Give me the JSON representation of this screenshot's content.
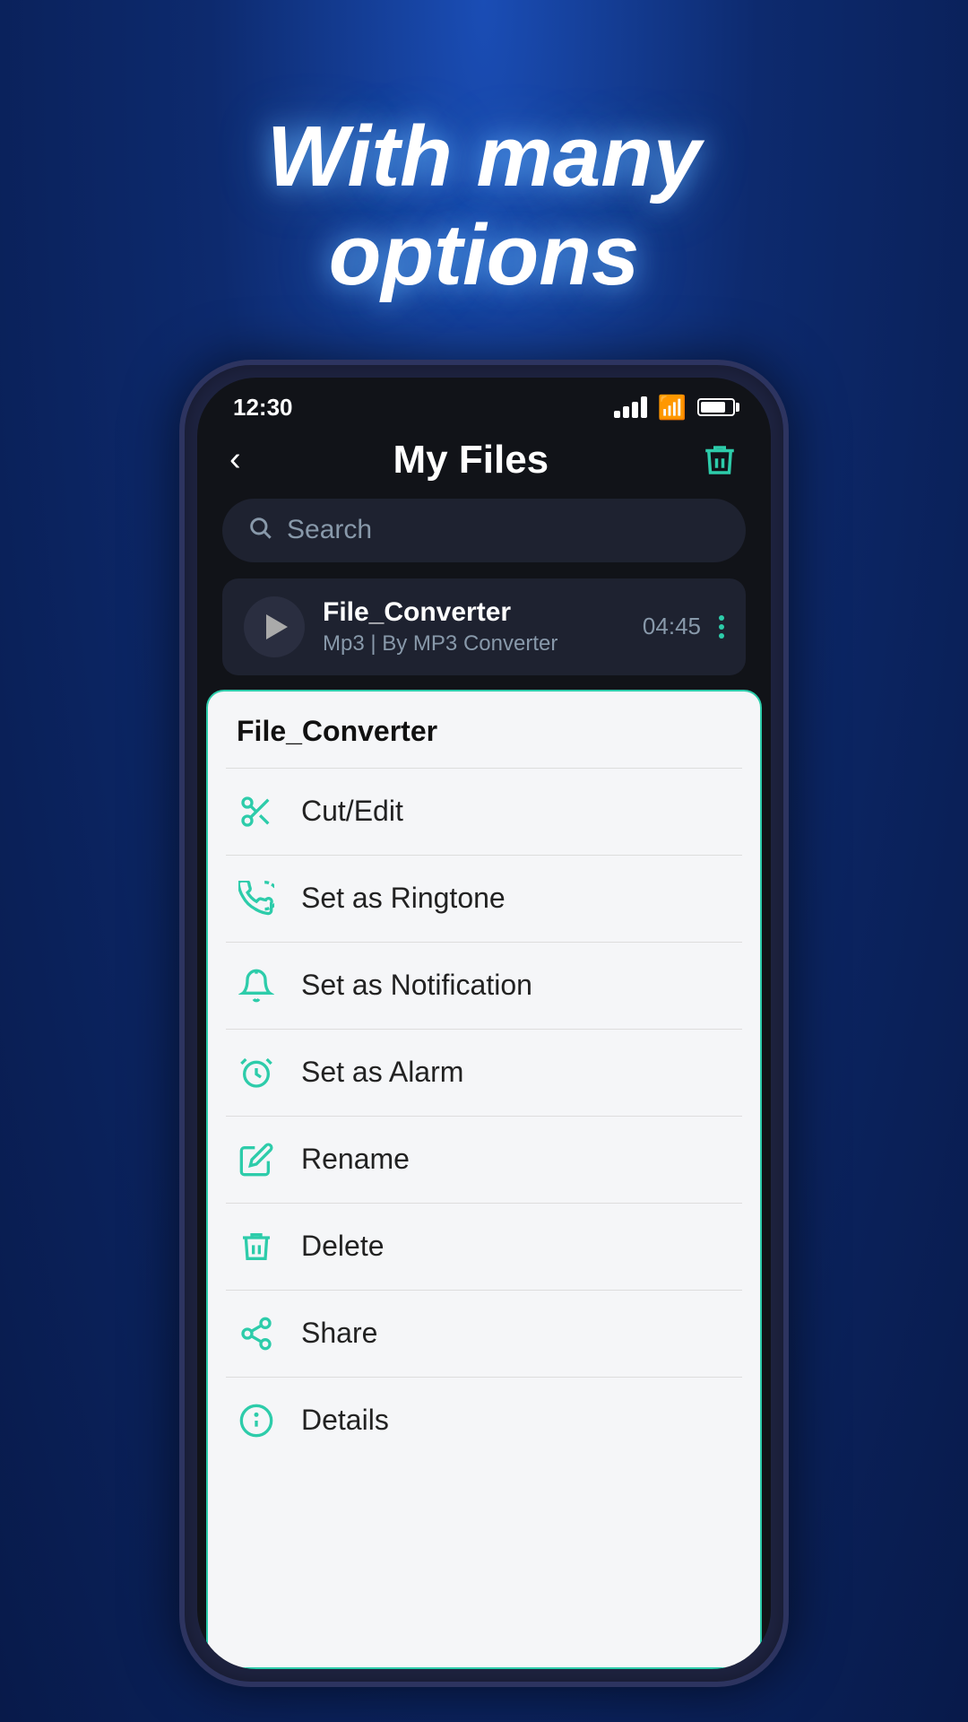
{
  "headline": {
    "line1": "With many",
    "line2": "options"
  },
  "status_bar": {
    "time": "12:30"
  },
  "app_bar": {
    "title": "My Files"
  },
  "search": {
    "placeholder": "Search"
  },
  "file_item": {
    "name": "File_Converter",
    "meta": "Mp3 | By MP3 Converter",
    "duration": "04:45"
  },
  "context_menu": {
    "title": "File_Converter",
    "items": [
      {
        "id": "cut-edit",
        "label": "Cut/Edit",
        "icon": "scissors"
      },
      {
        "id": "set-ringtone",
        "label": "Set as Ringtone",
        "icon": "phone"
      },
      {
        "id": "set-notification",
        "label": "Set as Notification",
        "icon": "bell"
      },
      {
        "id": "set-alarm",
        "label": "Set as Alarm",
        "icon": "alarm"
      },
      {
        "id": "rename",
        "label": "Rename",
        "icon": "pencil"
      },
      {
        "id": "delete",
        "label": "Delete",
        "icon": "trash"
      },
      {
        "id": "share",
        "label": "Share",
        "icon": "share"
      },
      {
        "id": "details",
        "label": "Details",
        "icon": "info"
      }
    ]
  }
}
